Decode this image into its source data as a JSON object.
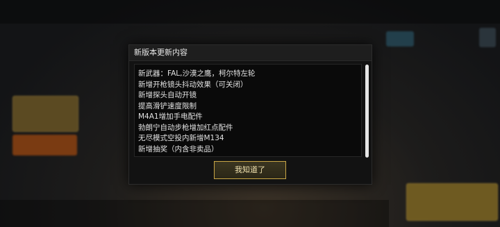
{
  "dialog": {
    "title": "新版本更新内容",
    "lines": [
      "新武器：FAL,沙漠之鹰，柯尔特左轮",
      "新增开枪镜头抖动效果（可关闭）",
      "新增探头自动开镜",
      "提高滑铲速度限制",
      "M4A1增加手电配件",
      "勃朗宁自动步枪增加红点配件",
      "无尽模式空投内新增M134",
      "新增抽奖（内含非卖品）"
    ],
    "confirm_label": "我知道了",
    "scroll_fraction_visible": 1.0
  },
  "colors": {
    "accent_gold": "#c9a646",
    "modal_bg": "#121212"
  }
}
